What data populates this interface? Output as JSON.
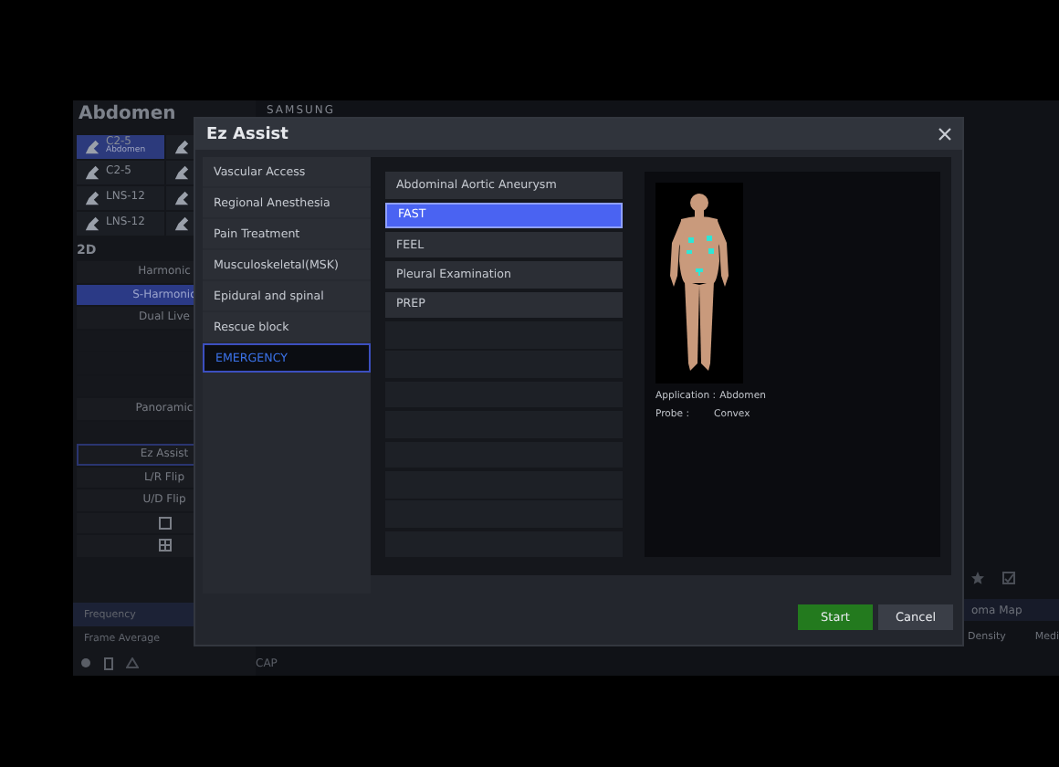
{
  "background": {
    "title": "Abdomen",
    "brand": "SAMSUNG",
    "probes": [
      {
        "name": "C2-5",
        "subtitle": "Abdomen",
        "selected": true
      },
      {
        "name": "C2-5",
        "selected": false
      },
      {
        "name": "LNS-12",
        "selected": false
      },
      {
        "name": "LNS-12",
        "selected": false
      }
    ],
    "section": "2D",
    "mode_buttons": [
      {
        "kind": "text",
        "label": "Harmonic",
        "selected": false,
        "outlined": false
      },
      {
        "kind": "text",
        "label": "S-Harmonic",
        "selected": true,
        "outlined": false
      },
      {
        "kind": "text",
        "label": "Dual Live",
        "selected": false,
        "outlined": false
      },
      {
        "kind": "blank"
      },
      {
        "kind": "blank"
      },
      {
        "kind": "blank"
      },
      {
        "kind": "text",
        "label": "Panoramic",
        "selected": false,
        "outlined": false
      },
      {
        "kind": "blank"
      },
      {
        "kind": "text",
        "label": "Ez Assist",
        "selected": false,
        "outlined": true
      },
      {
        "kind": "text",
        "label": "L/R Flip",
        "selected": false,
        "outlined": false
      },
      {
        "kind": "text",
        "label": "U/D Flip",
        "selected": false,
        "outlined": false
      },
      {
        "kind": "single-view"
      },
      {
        "kind": "quad-view"
      }
    ],
    "params": [
      {
        "label": "Frequency",
        "selected": true
      },
      {
        "label": "Frame Average",
        "selected": false
      }
    ],
    "status_text": "CAP",
    "right_items": [
      {
        "kind": "icons"
      },
      {
        "kind": "text",
        "label": "oma Map",
        "selected": true
      },
      {
        "kind": "pair",
        "label": "Density",
        "value": "Medi"
      }
    ]
  },
  "dialog": {
    "title": "Ez Assist",
    "categories": [
      {
        "label": "Vascular Access",
        "selected": false
      },
      {
        "label": "Regional Anesthesia",
        "selected": false
      },
      {
        "label": "Pain Treatment",
        "selected": false
      },
      {
        "label": "Musculoskeletal(MSK)",
        "selected": false
      },
      {
        "label": "Epidural and spinal",
        "selected": false
      },
      {
        "label": "Rescue block",
        "selected": false
      },
      {
        "label": "EMERGENCY",
        "selected": true
      }
    ],
    "protocols": [
      {
        "label": "Abdominal Aortic Aneurysm",
        "selected": false
      },
      {
        "label": "FAST",
        "selected": true
      },
      {
        "label": "FEEL",
        "selected": false
      },
      {
        "label": "Pleural Examination",
        "selected": false
      },
      {
        "label": "PREP",
        "selected": false
      }
    ],
    "preview": {
      "info": [
        {
          "label": "Application :",
          "value": "Abdomen"
        },
        {
          "label": "Probe :",
          "value": "Convex"
        }
      ]
    },
    "buttons": [
      {
        "label": "Start",
        "kind": "primary"
      },
      {
        "label": "Cancel",
        "kind": "secondary"
      }
    ]
  }
}
